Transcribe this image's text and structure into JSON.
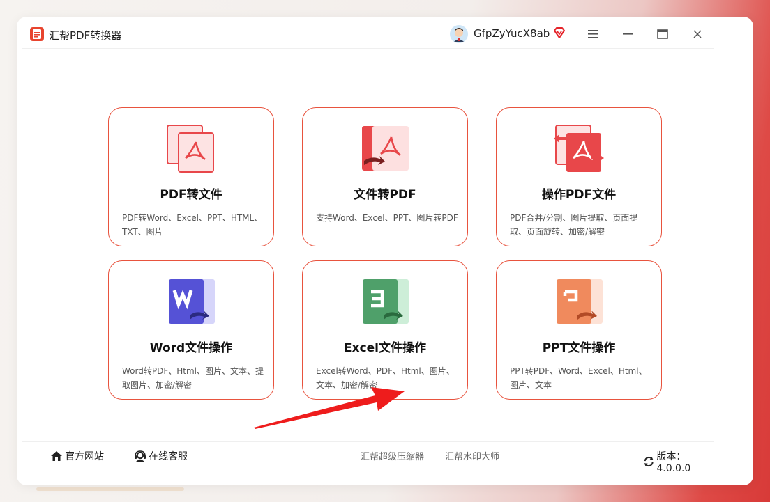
{
  "app": {
    "title": "汇帮PDF转换器",
    "username": "GfpZyYucX8ab"
  },
  "cards": [
    {
      "title": "PDF转文件",
      "desc": "PDF转Word、Excel、PPT、HTML、TXT、图片"
    },
    {
      "title": "文件转PDF",
      "desc": "支持Word、Excel、PPT、图片转PDF"
    },
    {
      "title": "操作PDF文件",
      "desc": "PDF合并/分割、图片提取、页面提取、页面旋转、加密/解密"
    },
    {
      "title": "Word文件操作",
      "desc": "Word转PDF、Html、图片、文本、提取图片、加密/解密"
    },
    {
      "title": "Excel文件操作",
      "desc": "Excel转Word、PDF、Html、图片、文本、加密/解密"
    },
    {
      "title": "PPT文件操作",
      "desc": "PPT转PDF、Word、Excel、Html、图片、文本"
    }
  ],
  "footer": {
    "website": "官方网站",
    "support": "在线客服",
    "link1": "汇帮超级压缩器",
    "link2": "汇帮水印大师",
    "version": "版本：4.0.0.0"
  },
  "colors": {
    "accent": "#e8533e",
    "word": "#5552d6",
    "excel": "#4fa06a",
    "ppt": "#f08a5d",
    "pdf": "#e8474a"
  },
  "icons": [
    "app-logo-icon",
    "avatar-icon",
    "vip-diamond-icon",
    "menu-icon",
    "minimize-icon",
    "maximize-icon",
    "close-icon",
    "home-icon",
    "headset-icon",
    "refresh-icon"
  ]
}
